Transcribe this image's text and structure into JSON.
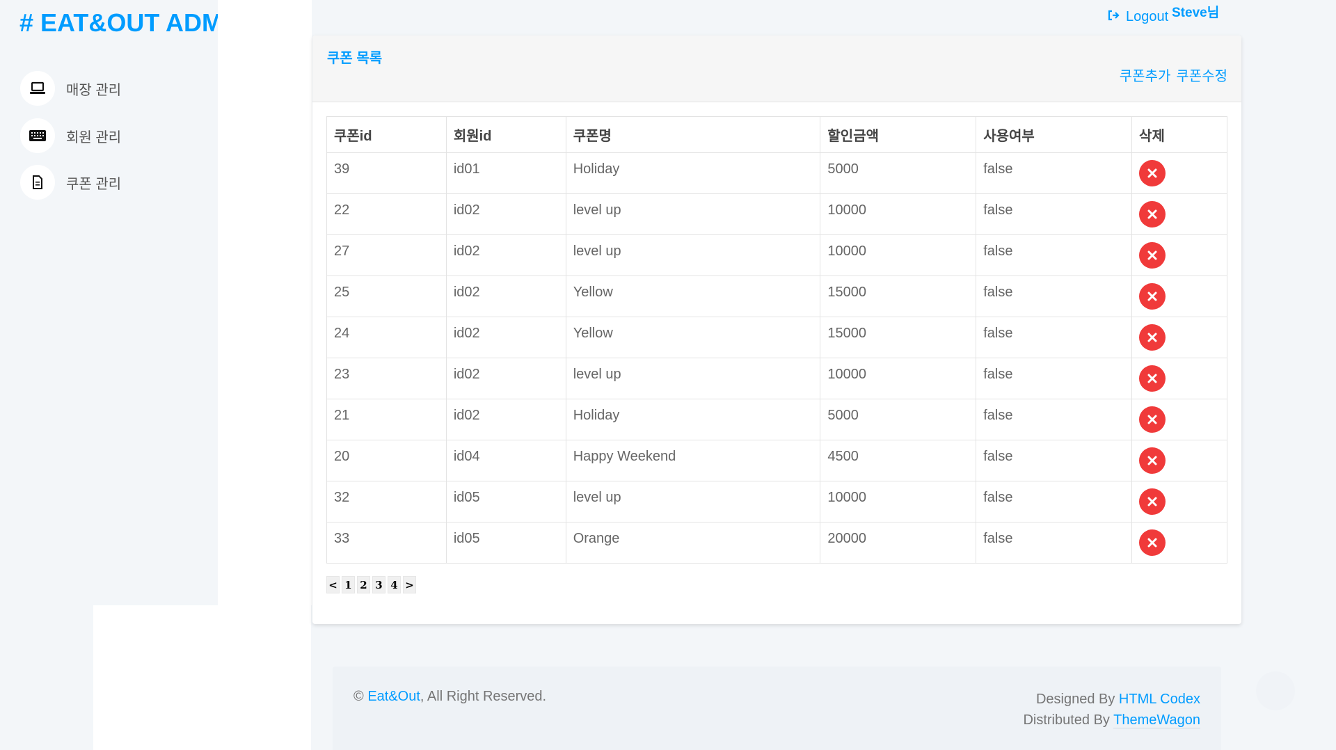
{
  "brand": "# EAT&OUT ADM",
  "sidebar": {
    "items": [
      {
        "label": "매장 관리",
        "icon": "laptop-icon"
      },
      {
        "label": "회원 관리",
        "icon": "keyboard-icon"
      },
      {
        "label": "쿠폰 관리",
        "icon": "document-icon"
      }
    ]
  },
  "topbar": {
    "logout": "Logout",
    "username": "Steve님"
  },
  "card": {
    "title": "쿠폰 목록",
    "add_link": "쿠폰추가",
    "edit_link": "쿠폰수정"
  },
  "table": {
    "headers": [
      "쿠폰id",
      "회원id",
      "쿠폰명",
      "할인금액",
      "사용여부",
      "삭제"
    ],
    "rows": [
      [
        "39",
        "id01",
        "Holiday",
        "5000",
        "false"
      ],
      [
        "22",
        "id02",
        "level up",
        "10000",
        "false"
      ],
      [
        "27",
        "id02",
        "level up",
        "10000",
        "false"
      ],
      [
        "25",
        "id02",
        "Yellow",
        "15000",
        "false"
      ],
      [
        "24",
        "id02",
        "Yellow",
        "15000",
        "false"
      ],
      [
        "23",
        "id02",
        "level up",
        "10000",
        "false"
      ],
      [
        "21",
        "id02",
        "Holiday",
        "5000",
        "false"
      ],
      [
        "20",
        "id04",
        "Happy Weekend",
        "4500",
        "false"
      ],
      [
        "32",
        "id05",
        "level up",
        "10000",
        "false"
      ],
      [
        "33",
        "id05",
        "Orange",
        "20000",
        "false"
      ]
    ]
  },
  "pager": [
    "<",
    "1",
    "2",
    "3",
    "4",
    ">"
  ],
  "footer": {
    "copyright_symbol": "©",
    "site_link": "Eat&Out",
    "rights": ", All Right Reserved.",
    "designed_by": "Designed By ",
    "designer_link": "HTML Codex",
    "distributed_by": "Distributed By ",
    "distributor_link": "ThemeWagon"
  },
  "colors": {
    "accent": "#009cff",
    "delete": "#f03a3a",
    "background": "#f3f6f9"
  }
}
